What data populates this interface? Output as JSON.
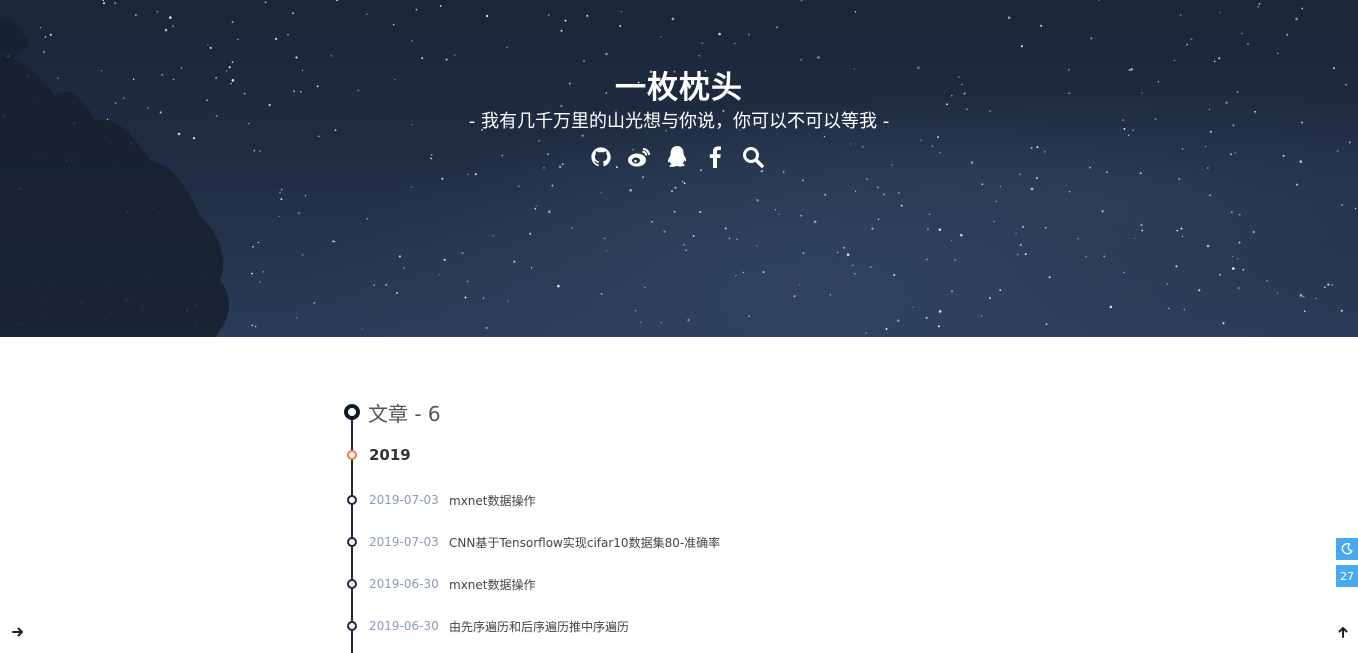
{
  "header": {
    "title": "一枚枕头",
    "subtitle": "- 我有几千万里的山光想与你说，你可以不可以等我 -",
    "social_icons": [
      "github-icon",
      "weibo-icon",
      "qq-icon",
      "facebook-icon",
      "search-icon"
    ]
  },
  "timeline": {
    "heading": "文章 - 6",
    "year": "2019",
    "posts": [
      {
        "date": "2019-07-03",
        "title": "mxnet数据操作"
      },
      {
        "date": "2019-07-03",
        "title": "CNN基于Tensorflow实现cifar10数据集80-准确率"
      },
      {
        "date": "2019-06-30",
        "title": "mxnet数据操作"
      },
      {
        "date": "2019-06-30",
        "title": "由先序遍历和后序遍历推中序遍历"
      }
    ]
  },
  "side_tools": {
    "night_mode_icon": "moon-icon",
    "counter": "27"
  },
  "colors": {
    "accent": "#49a9ee",
    "year_dot": "#ef7b4a",
    "timeline": "#1d2a3c",
    "date_text": "#8a9bb8"
  }
}
